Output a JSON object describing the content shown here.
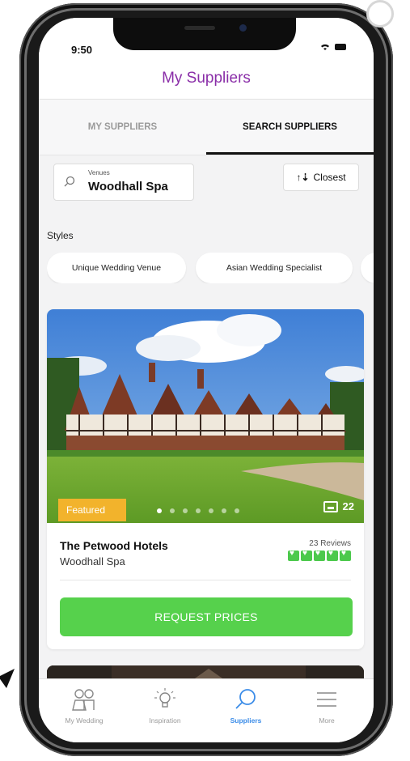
{
  "status": {
    "time": "9:50"
  },
  "header": {
    "title": "My Suppliers"
  },
  "tabs": [
    {
      "label": "MY SUPPLIERS",
      "active": false
    },
    {
      "label": "SEARCH SUPPLIERS",
      "active": true
    }
  ],
  "search": {
    "category": "Venues",
    "location": "Woodhall Spa",
    "sort_label": "Closest"
  },
  "styles": {
    "label": "Styles",
    "chips": [
      "Unique Wedding Venue",
      "Asian Wedding Specialist"
    ]
  },
  "listing": {
    "badge": "Featured",
    "photo_count": "22",
    "carousel_dots": 7,
    "carousel_active_index": 0,
    "name": "The Petwood Hotels",
    "location": "Woodhall Spa",
    "reviews": "23 Reviews",
    "rating": 5,
    "button": "REQUEST PRICES"
  },
  "tabbar": {
    "items": [
      {
        "label": "My Wedding",
        "icon": "couple-icon",
        "active": false
      },
      {
        "label": "Inspiration",
        "icon": "lightbulb-icon",
        "active": false
      },
      {
        "label": "Suppliers",
        "icon": "search-icon",
        "active": true
      },
      {
        "label": "More",
        "icon": "menu-icon",
        "active": false
      }
    ]
  },
  "colors": {
    "title": "#8a2ea8",
    "accent_green": "#56d14c",
    "featured": "#f2b32c",
    "active_tab": "#3b8ce8"
  }
}
